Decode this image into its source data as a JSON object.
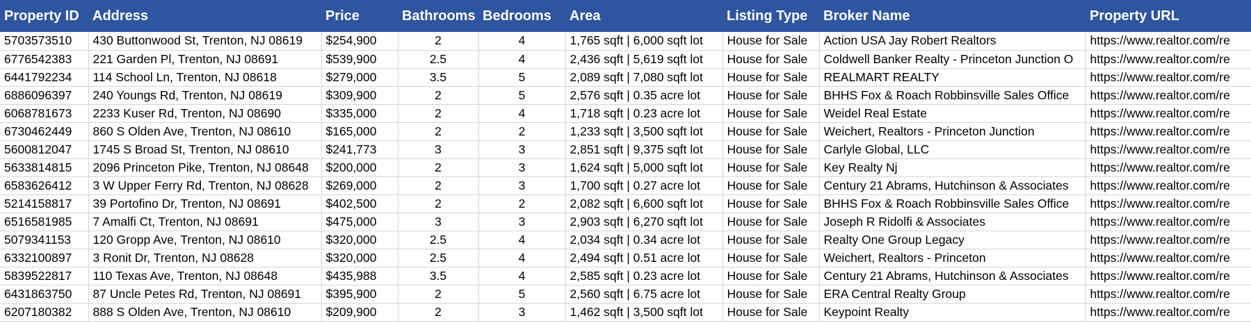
{
  "headers": [
    "Property ID",
    "Address",
    "Price",
    "Bathrooms",
    "Bedrooms",
    "Area",
    "Listing Type",
    "Broker Name",
    "Property URL"
  ],
  "rows": [
    [
      "5703573510",
      "430 Buttonwood St, Trenton, NJ 08619",
      "$254,900",
      "2",
      "4",
      "1,765 sqft | 6,000 sqft lot",
      "House for Sale",
      "Action USA Jay Robert Realtors",
      "https://www.realtor.com/re"
    ],
    [
      "6776542383",
      "221 Garden Pl, Trenton, NJ 08691",
      "$539,900",
      "2.5",
      "4",
      "2,436 sqft | 5,619 sqft lot",
      "House for Sale",
      "Coldwell Banker Realty - Princeton Junction O",
      "https://www.realtor.com/re"
    ],
    [
      "6441792234",
      "114 School Ln, Trenton, NJ 08618",
      "$279,000",
      "3.5",
      "5",
      "2,089 sqft | 7,080 sqft lot",
      "House for Sale",
      "REALMART REALTY",
      "https://www.realtor.com/re"
    ],
    [
      "6886096397",
      "240 Youngs Rd, Trenton, NJ 08619",
      "$309,900",
      "2",
      "5",
      "2,576 sqft | 0.35 acre lot",
      "House for Sale",
      "BHHS Fox & Roach Robbinsville Sales Office",
      "https://www.realtor.com/re"
    ],
    [
      "6068781673",
      "2233 Kuser Rd, Trenton, NJ 08690",
      "$335,000",
      "2",
      "4",
      "1,718 sqft | 0.23 acre lot",
      "House for Sale",
      "Weidel Real Estate",
      "https://www.realtor.com/re"
    ],
    [
      "6730462449",
      "860 S Olden Ave, Trenton, NJ 08610",
      "$165,000",
      "2",
      "2",
      "1,233 sqft | 3,500 sqft lot",
      "House for Sale",
      "Weichert, Realtors - Princeton Junction",
      "https://www.realtor.com/re"
    ],
    [
      "5600812047",
      "1745 S Broad St, Trenton, NJ 08610",
      "$241,773",
      "3",
      "3",
      "2,851 sqft | 9,375 sqft lot",
      "House for Sale",
      "Carlyle Global, LLC",
      "https://www.realtor.com/re"
    ],
    [
      "5633814815",
      "2096 Princeton Pike, Trenton, NJ 08648",
      "$200,000",
      "2",
      "3",
      "1,624 sqft | 5,000 sqft lot",
      "House for Sale",
      "Key Realty Nj",
      "https://www.realtor.com/re"
    ],
    [
      "6583626412",
      "3 W Upper Ferry Rd, Trenton, NJ 08628",
      "$269,000",
      "2",
      "3",
      "1,700 sqft | 0.27 acre lot",
      "House for Sale",
      "Century 21 Abrams, Hutchinson & Associates",
      "https://www.realtor.com/re"
    ],
    [
      "5214158817",
      "39 Portofino Dr, Trenton, NJ 08691",
      "$402,500",
      "2",
      "2",
      "2,082 sqft | 6,600 sqft lot",
      "House for Sale",
      "BHHS Fox & Roach Robbinsville Sales Office",
      "https://www.realtor.com/re"
    ],
    [
      "6516581985",
      "7 Amalfi Ct, Trenton, NJ 08691",
      "$475,000",
      "3",
      "3",
      "2,903 sqft | 6,270 sqft lot",
      "House for Sale",
      "Joseph R Ridolfi & Associates",
      "https://www.realtor.com/re"
    ],
    [
      "5079341153",
      "120 Gropp Ave, Trenton, NJ 08610",
      "$320,000",
      "2.5",
      "4",
      "2,034 sqft | 0.34 acre lot",
      "House for Sale",
      "Realty One Group Legacy",
      "https://www.realtor.com/re"
    ],
    [
      "6332100897",
      "3 Ronit Dr, Trenton, NJ 08628",
      "$320,000",
      "2.5",
      "4",
      "2,494 sqft | 0.51 acre lot",
      "House for Sale",
      "Weichert, Realtors - Princeton",
      "https://www.realtor.com/re"
    ],
    [
      "5839522817",
      "110 Texas Ave, Trenton, NJ 08648",
      "$435,988",
      "3.5",
      "4",
      "2,585 sqft | 0.23 acre lot",
      "House for Sale",
      "Century 21 Abrams, Hutchinson & Associates",
      "https://www.realtor.com/re"
    ],
    [
      "6431863750",
      "87 Uncle Petes Rd, Trenton, NJ 08691",
      "$395,900",
      "2",
      "5",
      "2,560 sqft | 6.75 acre lot",
      "House for Sale",
      "ERA Central Realty Group",
      "https://www.realtor.com/re"
    ],
    [
      "6207180382",
      "888 S Olden Ave, Trenton, NJ 08610",
      "$209,900",
      "2",
      "3",
      "1,462 sqft | 3,500 sqft lot",
      "House for Sale",
      "Keypoint Realty",
      "https://www.realtor.com/re"
    ]
  ]
}
